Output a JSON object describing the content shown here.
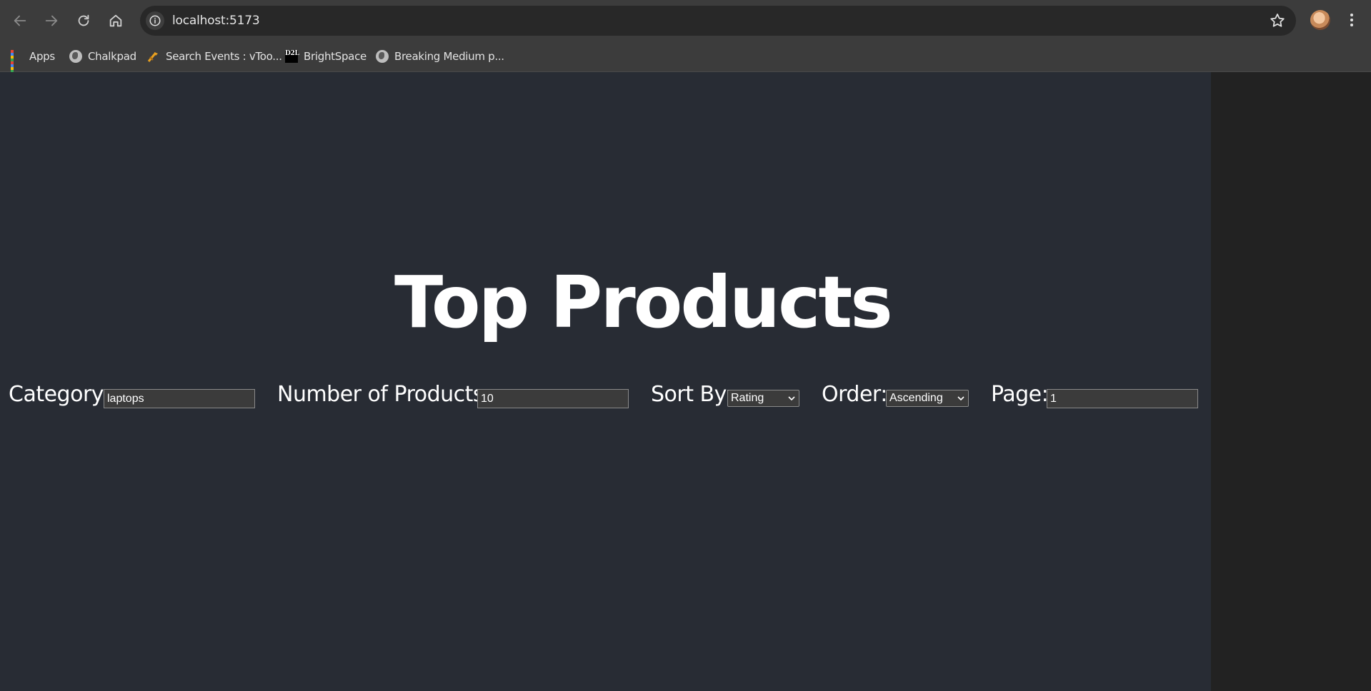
{
  "browser": {
    "url": "localhost:5173",
    "bookmarks": [
      {
        "label": "Apps",
        "icon": "apps-grid-icon"
      },
      {
        "label": "Chalkpad",
        "icon": "globe-icon"
      },
      {
        "label": "Search Events : vToo...",
        "icon": "vtools-icon"
      },
      {
        "label": "BrightSpace",
        "icon": "d2l-icon"
      },
      {
        "label": "Breaking Medium p...",
        "icon": "globe-icon"
      }
    ],
    "d2l_icon_text": "D2L"
  },
  "page": {
    "title": "Top Products",
    "controls": {
      "category_label": "Category:",
      "category_value": "laptops",
      "num_products_label": "Number of Products:",
      "num_products_value": "10",
      "sort_by_label": "Sort By:",
      "sort_by_value": "Rating",
      "order_label": "Order:",
      "order_value": "Ascending",
      "page_label": "Page:",
      "page_value": "1"
    }
  },
  "colors": {
    "background": "#282c34",
    "browser_chrome": "#3c3c3c",
    "text": "#ffffff"
  }
}
